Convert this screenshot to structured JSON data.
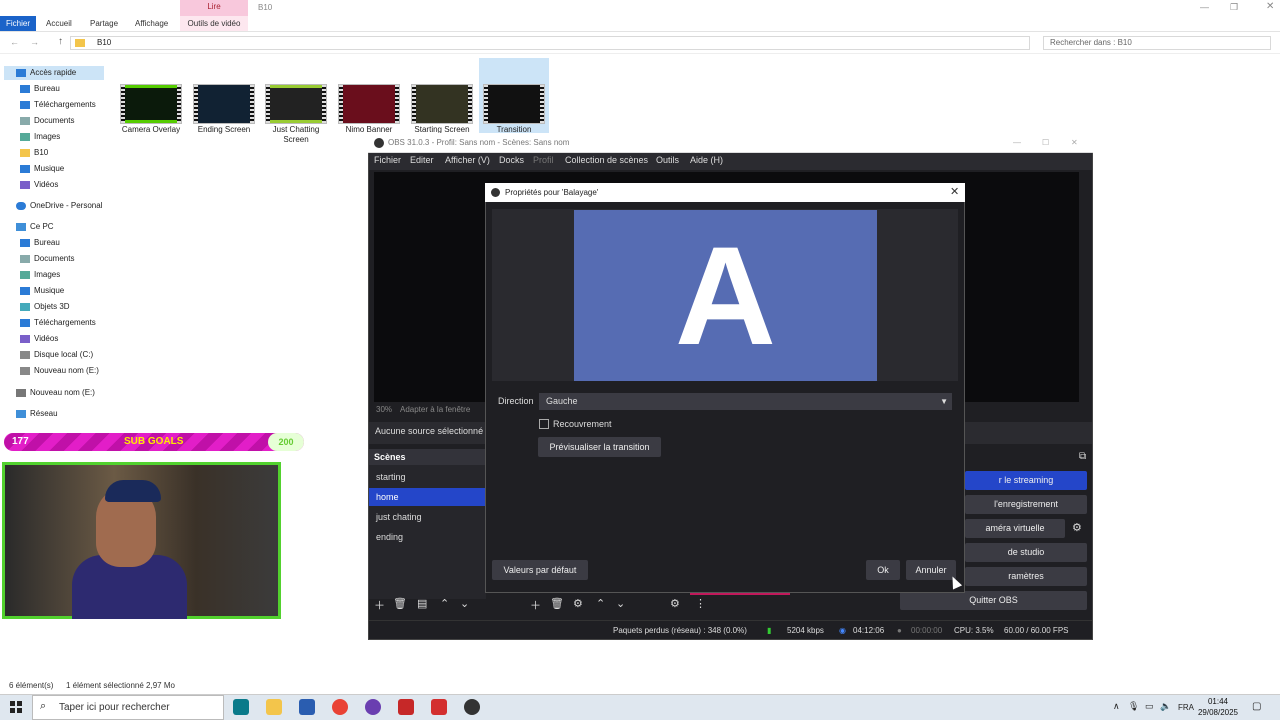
{
  "explorer": {
    "tabs": [
      "Fichier",
      "Accueil",
      "Partage",
      "Affichage",
      "Outils de vidéo"
    ],
    "context_tab": "Lire",
    "window_title": "B10",
    "address": "B10",
    "search_placeholder": "Rechercher dans : B10",
    "nav": {
      "quick_access": "Accès rapide",
      "quick_items": [
        "Bureau",
        "Téléchargements",
        "Documents",
        "Images",
        "B10",
        "Musique",
        "Vidéos"
      ],
      "onedrive": "OneDrive - Personal",
      "this_pc": "Ce PC",
      "pc_items": [
        "Bureau",
        "Documents",
        "Images",
        "Musique",
        "Objets 3D",
        "Téléchargements",
        "Vidéos",
        "Disque local (C:)",
        "Nouveau nom (E:)"
      ],
      "drive": "Nouveau nom (E:)",
      "network": "Réseau"
    },
    "files": [
      {
        "name": "Camera Overlay"
      },
      {
        "name": "Ending Screen"
      },
      {
        "name": "Just Chatting Screen"
      },
      {
        "name": "Nimo Banner"
      },
      {
        "name": "Starting Screen"
      },
      {
        "name": "Transition"
      }
    ],
    "status_count": "6 élément(s)",
    "status_selected": "1 élément sélectionné  2,97 Mo"
  },
  "overlay": {
    "goal_left": "177",
    "goal_title": "SUB GOALS",
    "goal_right": "200"
  },
  "obs": {
    "title": "OBS 31.0.3 - Profil: Sans nom - Scènes: Sans nom",
    "menu": [
      "Fichier",
      "Editer",
      "Afficher (V)",
      "Docks",
      "Profil",
      "Collection de scènes",
      "Outils",
      "Aide (H)"
    ],
    "zoom": "30%",
    "fit": "Adapter à la fenêtre",
    "no_source": "Aucune source sélectionné",
    "scenes_header": "Scènes",
    "scenes": [
      "starting",
      "home",
      "just chating",
      "ending"
    ],
    "controls": [
      "r le streaming",
      "l'enregistrement",
      "améra virtuelle",
      "de studio",
      "ramètres",
      "Quitter OBS"
    ],
    "status": {
      "dropped": "Paquets perdus (réseau) : 348 (0.0%)",
      "bitrate": "5204 kbps",
      "stream_time": "04:12:06",
      "rec_time": "00:00:00",
      "cpu": "CPU: 3.5%",
      "fps": "60.00 / 60.00 FPS"
    }
  },
  "dialog": {
    "title": "Propriétés pour 'Balayage'",
    "preview_letter": "A",
    "direction_label": "Direction",
    "direction_value": "Gauche",
    "overlap_label": "Recouvrement",
    "preview_button": "Prévisualiser la transition",
    "defaults_button": "Valeurs par défaut",
    "ok_button": "Ok",
    "cancel_button": "Annuler"
  },
  "taskbar": {
    "search": "Taper ici pour rechercher",
    "lang": "FRA",
    "time": "01:44",
    "date": "29/08/2025"
  }
}
